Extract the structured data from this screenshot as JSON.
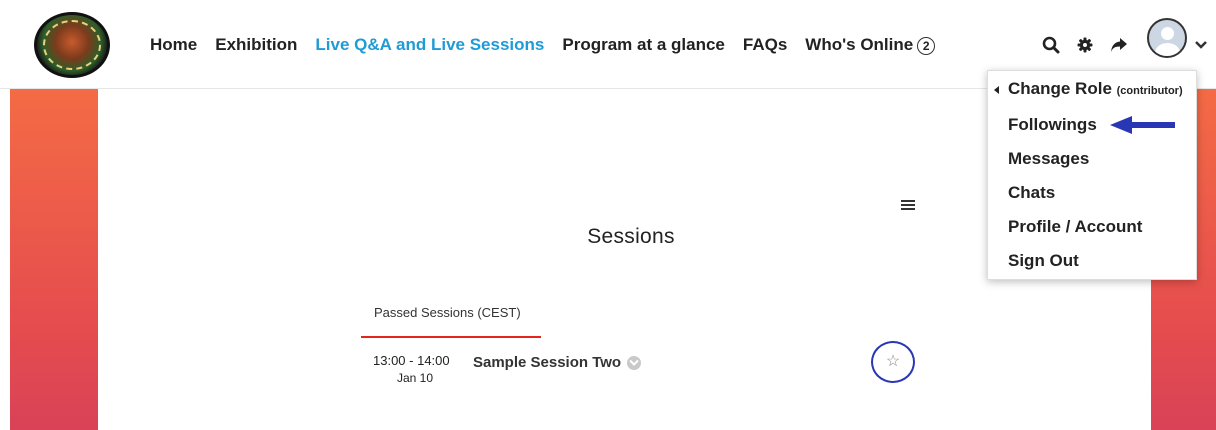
{
  "nav": {
    "items": [
      {
        "label": "Home"
      },
      {
        "label": "Exhibition"
      },
      {
        "label": "Live Q&A and Live Sessions",
        "active": true
      },
      {
        "label": "Program at a glance"
      },
      {
        "label": "FAQs"
      },
      {
        "label": "Who's Online",
        "badge": "2"
      }
    ]
  },
  "tools": [
    {
      "icon": "search-icon"
    },
    {
      "icon": "gear-icon"
    },
    {
      "icon": "share-icon"
    },
    {
      "icon": "avatar"
    },
    {
      "icon": "chevron-down-icon"
    }
  ],
  "menu": {
    "change_role_label": "Change Role",
    "change_role_note": "(contributor)",
    "items": [
      "Followings",
      "Messages",
      "Chats",
      "Profile / Account",
      "Sign Out"
    ]
  },
  "main": {
    "title": "Sessions",
    "tab_label": "Passed Sessions (CEST)",
    "session": {
      "time": "13:00 - 14:00",
      "date": "Jan 10",
      "name": "Sample Session Two"
    }
  },
  "colors": {
    "accent": "#1f9bd6",
    "tab_underline": "#e2261c",
    "highlight": "#2a37b5",
    "side_bar_top": "#f46b45",
    "side_bar_bottom": "#d94257"
  }
}
